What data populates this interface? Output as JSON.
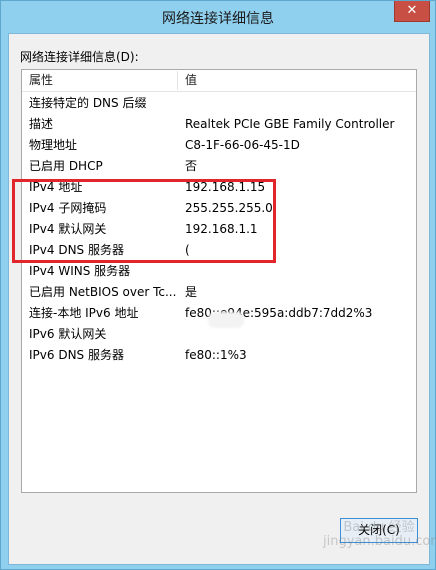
{
  "window": {
    "title": "网络连接详细信息",
    "close_glyph": "✕"
  },
  "group_label": "网络连接详细信息(D):",
  "table": {
    "columns": [
      "属性",
      "值"
    ],
    "rows": [
      {
        "property": "连接特定的 DNS 后缀",
        "value": ""
      },
      {
        "property": "描述",
        "value": "Realtek PCIe GBE Family Controller"
      },
      {
        "property": "物理地址",
        "value": "C8-1F-66-06-45-1D"
      },
      {
        "property": "已启用 DHCP",
        "value": "否"
      },
      {
        "property": "IPv4 地址",
        "value": "192.168.1.15"
      },
      {
        "property": "IPv4 子网掩码",
        "value": "255.255.255.0"
      },
      {
        "property": "IPv4 默认网关",
        "value": "192.168.1.1"
      },
      {
        "property": "IPv4 DNS 服务器",
        "value": "("
      },
      {
        "property": "IPv4 WINS 服务器",
        "value": ""
      },
      {
        "property": "已启用 NetBIOS over Tc...",
        "value": "是"
      },
      {
        "property": "连接-本地 IPv6 地址",
        "value": "fe80::e94e:595a:ddb7:7dd2%3"
      },
      {
        "property": "IPv6 默认网关",
        "value": ""
      },
      {
        "property": "IPv6 DNS 服务器",
        "value": "fe80::1%3"
      }
    ]
  },
  "buttons": {
    "close_label": "关闭(C)"
  },
  "watermark": "Bai du 经验\njingyan.baidu.com",
  "colors": {
    "titlebar": "#8fd0ee",
    "close_button": "#c74f44",
    "highlight_box": "#e0262b"
  }
}
